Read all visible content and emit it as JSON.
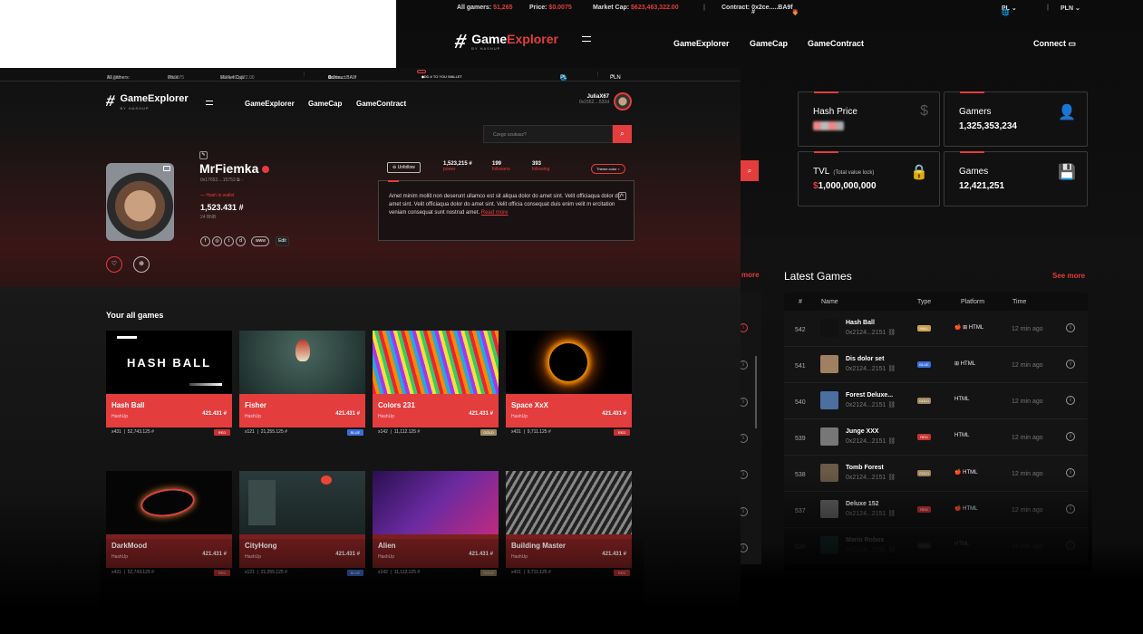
{
  "back": {
    "ticker": {
      "gamers_label": "All gamers:",
      "gamers": "51,265",
      "price_label": "Price:",
      "price": "$0.0075",
      "cap_label": "Market Cap:",
      "cap": "$623,463,322.00",
      "contract_label": "Contract:",
      "contract": "0x2ce.....BA9f",
      "lang": "PL",
      "currency": "PLN"
    },
    "logo": {
      "name_a": "Game",
      "name_b": "Explorer",
      "sub": "BY HASHUP"
    },
    "nav": [
      "GameExplorer",
      "GameCap",
      "GameContract"
    ],
    "connect": "Connect",
    "stats": [
      {
        "label": "Hash Price",
        "value": "",
        "icon": "$"
      },
      {
        "label": "Gamers",
        "value": "1,325,353,234",
        "icon": "👤"
      },
      {
        "label": "TVL",
        "note": "(Total value lock)",
        "value_symbol": "$",
        "value": "1,000,000,000",
        "icon": "🔒"
      },
      {
        "label": "Games",
        "value": "12,421,251",
        "icon": "💾"
      }
    ],
    "latest_title": "Latest Games",
    "see_more": "See more",
    "left_more": "more",
    "columns": [
      "#",
      "Name",
      "Type",
      "Platform",
      "Time"
    ],
    "rows": [
      {
        "n": "542",
        "name": "Hash Ball",
        "addr": "0x2124...2151",
        "type": "HALL",
        "type_color": "#c9a24a",
        "platform": "🍎 ⊞  HTML",
        "time": "12 min ago",
        "thumb": "#111"
      },
      {
        "n": "541",
        "name": "Dis dolor set",
        "addr": "0x2124...2151",
        "type": "BLUE",
        "type_color": "#3a6fd8",
        "platform": "⊞  HTML",
        "time": "12 min ago",
        "thumb": "#a08060"
      },
      {
        "n": "540",
        "name": "Forest Deluxe...",
        "addr": "0x2124...2151",
        "type": "GOLD",
        "type_color": "#a08a60",
        "platform": "HTML",
        "time": "12 min ago",
        "thumb": "#4a6fa0"
      },
      {
        "n": "539",
        "name": "Junge XXX",
        "addr": "0x2124...2151",
        "type": "RED",
        "type_color": "#c83232",
        "platform": "HTML",
        "time": "12 min ago",
        "thumb": "#777"
      },
      {
        "n": "538",
        "name": "Tomb Forest",
        "addr": "0x2124...2151",
        "type": "GOLD",
        "type_color": "#a08a60",
        "platform": "🍎  HTML",
        "time": "12 min ago",
        "thumb": "#6a5a48"
      },
      {
        "n": "537",
        "name": "Deluxe 152",
        "addr": "0x2124...2151",
        "type": "RED",
        "type_color": "#c83232",
        "platform": "🍎  HTML",
        "time": "12 min ago",
        "thumb": "#666"
      },
      {
        "n": "536",
        "name": "Mario Robox",
        "addr": "0x2124...2151",
        "type": "GOLD",
        "type_color": "#555",
        "platform": "HTML",
        "time": "12 min ago",
        "thumb": "#2a6b6b"
      }
    ]
  },
  "front": {
    "ticker": {
      "gamers_label": "All gamers:",
      "gamers": "51,265",
      "price_label": "Price:",
      "price": "$0.0075",
      "cap_label": "Market Cap:",
      "cap": "$623,463,322.00",
      "contract_label": "Contract:",
      "contract": "0x2ce.....BA9f",
      "add_label": "ADD # TO YOU WALLET",
      "lang": "PL",
      "currency": "PLN"
    },
    "logo": {
      "name": "GameExplorer",
      "sub": "BY HASHUP"
    },
    "nav": [
      "GameExplorer",
      "GameCap",
      "GameContract"
    ],
    "user": {
      "name": "JuliaX67",
      "addr": "0x1552....532d"
    },
    "search_placeholder": "Czego szukasz?",
    "profile": {
      "name": "MrFiemka",
      "addr": "0x17653....15753",
      "wallet_label": "Hash in wallet",
      "wallet_value": "1,523.431",
      "wallet_bnb": "24 BNB",
      "www": "www",
      "edit": "Edit",
      "unfollow": "Unfollow",
      "power_value": "1,523,215",
      "power_label": "power",
      "followers_value": "199",
      "followers_label": "followers",
      "following_value": "393",
      "following_label": "following",
      "theme": "Theme color",
      "bio": "Amet minim mollit non deserunt ullamco est sit aliqua dolor do amet sint. Velit officiaqua dolor do amet sint. Velit officiaqua dolor do amet sint. Velit officia consequat duis enim velit m ercitation veniam consequat sunt nostrud amet.",
      "read_more": "Read more"
    },
    "section_title": "Your all games",
    "cards": [
      {
        "name": "Hash Ball",
        "studio": "HashUp",
        "price": "421.431",
        "count": "x431",
        "vol": "52,743.125",
        "tag": "RED",
        "tag_color": "#c83232",
        "img": "hashball"
      },
      {
        "name": "Fisher",
        "studio": "HashUp",
        "price": "421.431",
        "count": "x121",
        "vol": "21,255.125",
        "tag": "BLUE",
        "tag_color": "#3a6fd8",
        "img": "fisher"
      },
      {
        "name": "Colors 231",
        "studio": "HashUp",
        "price": "421.431",
        "count": "x142",
        "vol": "11,112.125",
        "tag": "GOLD",
        "tag_color": "#a08a60",
        "img": "colors"
      },
      {
        "name": "Space XxX",
        "studio": "HashUp",
        "price": "421.431",
        "count": "x431",
        "vol": "9,711.125",
        "tag": "RED",
        "tag_color": "#c83232",
        "img": "space"
      },
      {
        "name": "DarkMood",
        "studio": "HashUp",
        "price": "421.431",
        "count": "x431",
        "vol": "52,743.125",
        "tag": "RED",
        "tag_color": "#c83232",
        "img": "dark"
      },
      {
        "name": "CityHong",
        "studio": "HashUp",
        "price": "421.431",
        "count": "x121",
        "vol": "21,255.125",
        "tag": "BLUE",
        "tag_color": "#3a6fd8",
        "img": "city"
      },
      {
        "name": "Alien",
        "studio": "HashUp",
        "price": "421.431",
        "count": "x142",
        "vol": "11,112.125",
        "tag": "GOLD",
        "tag_color": "#a08a60",
        "img": "alien"
      },
      {
        "name": "Building Master",
        "studio": "HashUp",
        "price": "421.431",
        "count": "x431",
        "vol": "9,711.125",
        "tag": "RED",
        "tag_color": "#c83232",
        "img": "building"
      }
    ]
  }
}
